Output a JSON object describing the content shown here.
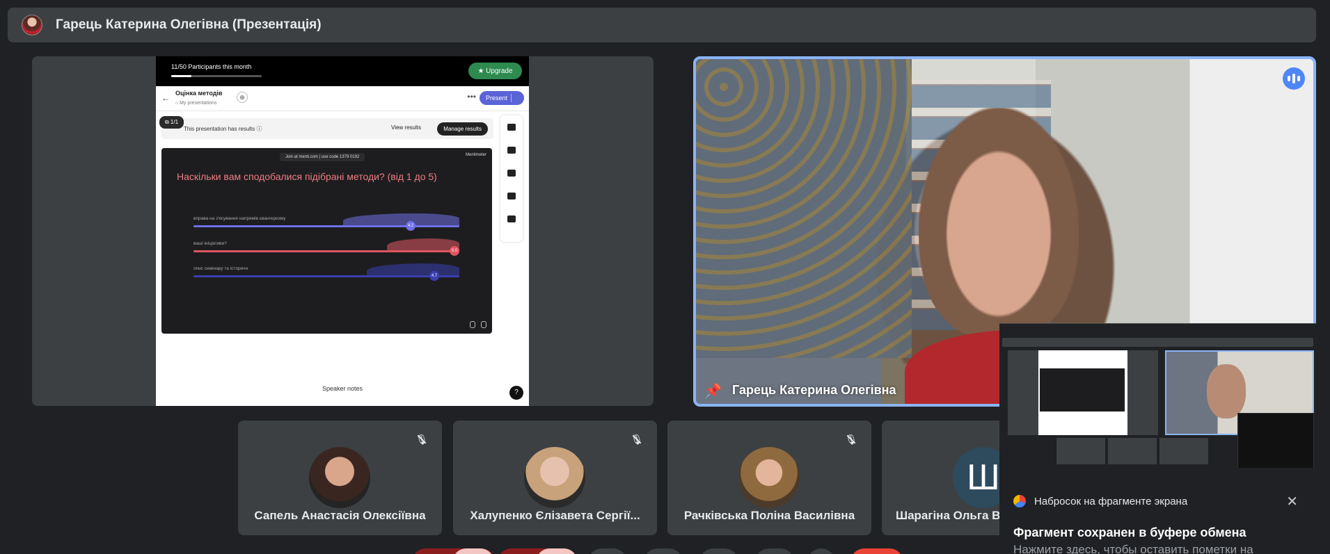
{
  "topbar": {
    "title": "Гарець Катерина Олегівна (Презентація)"
  },
  "presentation": {
    "participants_label": "11/50  Participants this month",
    "participants_fill": 0.22,
    "upgrade_label": "★ Upgrade",
    "back_icon": "←",
    "name": "Оцінка методів",
    "breadcrumb": "⌂ My presentations",
    "share_icon": "⊕",
    "more_icon": "•••",
    "present_label": "Present",
    "slide_count": "⧉ 1/1",
    "results_text": "This presentation has results  ⓘ",
    "view_results": "View results",
    "manage_results": "Manage results",
    "slide": {
      "join_text": "Join at menti.com | use code  1379 0192",
      "brand": "Mentimeter",
      "question": "Наскільки вам сподобалися підібрані методи? (від 1 до 5)",
      "rows": [
        {
          "label": "вправа на з'ясування напрямів євангеризму",
          "value": "4.2",
          "color": "#6f6fe8",
          "level": 0.83
        },
        {
          "label": "ваші ініціативи?",
          "value": "5.0",
          "color": "#e05560",
          "level": 1.0
        },
        {
          "label": "опис семінару та історичн",
          "value": "4.7",
          "color": "#3b3fb0",
          "level": 0.92
        }
      ]
    },
    "speaker_notes": "Speaker notes",
    "help": "?"
  },
  "video": {
    "name": "Гарець Катерина Олегівна",
    "pin_icon": "📌"
  },
  "participants": [
    {
      "name": "Сапель Анастасія Олексіївна",
      "muted": true
    },
    {
      "name": "Халупенко Єлізавета Сергії...",
      "muted": true
    },
    {
      "name": "Рачківська Поліна Василівна",
      "muted": true
    },
    {
      "name": "Шарагіна Ольга В",
      "letter": "Ш",
      "muted": false
    }
  ],
  "snip": {
    "app_name": "Набросок на фрагменте экрана",
    "close_icon": "✕",
    "message": "Фрагмент сохранен в буфере обмена",
    "subtext": "Нажмите здесь, чтобы оставить пометки на"
  },
  "colors": {
    "background": "#202124",
    "tile": "#3c4043",
    "active_border": "#8ab4f8",
    "upgrade": "#2e8a4f",
    "present": "#5b63d8"
  }
}
